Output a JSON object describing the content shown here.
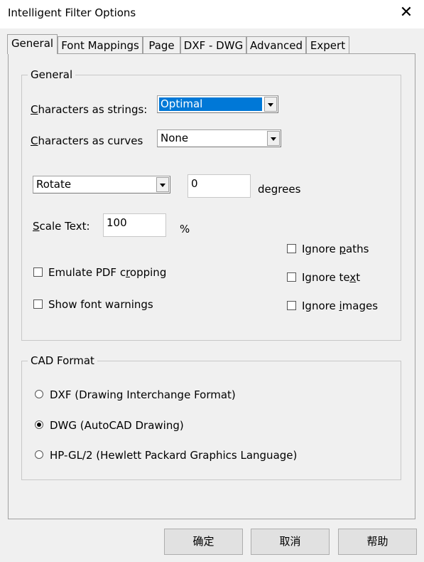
{
  "window": {
    "title": "Intelligent Filter Options",
    "close_glyph": "✕"
  },
  "tabs": [
    {
      "label": "General"
    },
    {
      "label": "Font Mappings"
    },
    {
      "label": "Page"
    },
    {
      "label": "DXF - DWG"
    },
    {
      "label": "Advanced"
    },
    {
      "label": "Expert"
    }
  ],
  "general_group": {
    "label": "General",
    "chars_as_strings": {
      "label": "Characters as strings:",
      "mnemonic": "C",
      "rest": "haracters as strings:",
      "value": "Optimal"
    },
    "chars_as_curves": {
      "label": "Characters as curves",
      "mnemonic": "C",
      "rest": "haracters as curves",
      "value": "None"
    },
    "rotate": {
      "value": "Rotate",
      "degrees_value": "0",
      "unit": "degrees"
    },
    "scale_text": {
      "mnemonic": "S",
      "rest": "cale Text:",
      "value": "100",
      "unit": "%"
    },
    "emulate_pdf_cropping": {
      "pre": "Emulate PDF c",
      "mnemonic": "r",
      "post": "opping",
      "checked": false
    },
    "show_font_warnings": {
      "label": "Show font warnings",
      "checked": false
    },
    "ignore_paths": {
      "pre": "Ignore ",
      "mnemonic": "p",
      "post": "aths",
      "checked": false
    },
    "ignore_text": {
      "pre": "Ignore te",
      "mnemonic": "x",
      "post": "t",
      "checked": false
    },
    "ignore_images": {
      "pre": "Ignore ",
      "mnemonic": "i",
      "post": "mages",
      "checked": false
    }
  },
  "cad_group": {
    "label": "CAD Format",
    "options": [
      {
        "label": "DXF (Drawing Interchange Format)",
        "selected": false
      },
      {
        "label": "DWG (AutoCAD Drawing)",
        "selected": true
      },
      {
        "label": "HP-GL/2 (Hewlett Packard Graphics Language)",
        "selected": false
      }
    ]
  },
  "buttons": {
    "ok": "确定",
    "cancel": "取消",
    "help": "帮助"
  }
}
